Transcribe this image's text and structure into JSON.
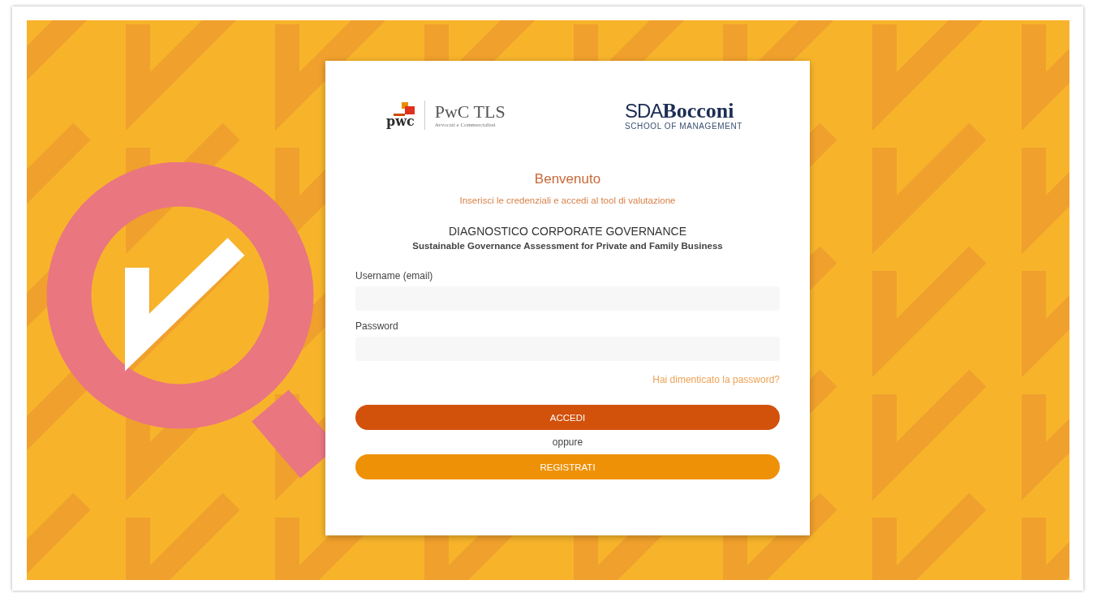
{
  "logos": {
    "pwc": {
      "wordmark": "pwc",
      "name": "PwC TLS",
      "tagline": "Avvocati e Commercialisti"
    },
    "bocconi": {
      "prefix": "SDA",
      "name": "Bocconi",
      "tagline": "SCHOOL OF MANAGEMENT"
    }
  },
  "welcome": {
    "title": "Benvenuto",
    "subtitle": "Inserisci le credenziali e accedi al tool di valutazione"
  },
  "product": {
    "title": "DIAGNOSTICO CORPORATE GOVERNANCE",
    "subtitle": "Sustainable Governance Assessment for Private and Family Business"
  },
  "fields": [
    {
      "label": "Username (email)"
    },
    {
      "label": "Password"
    }
  ],
  "forgot_link": "Hai dimenticato la password?",
  "buttons": [
    {
      "label": "ACCEDI",
      "kind": "primary"
    },
    {
      "label": "REGISTRATI",
      "kind": "secondary"
    }
  ],
  "separator": "oppure"
}
